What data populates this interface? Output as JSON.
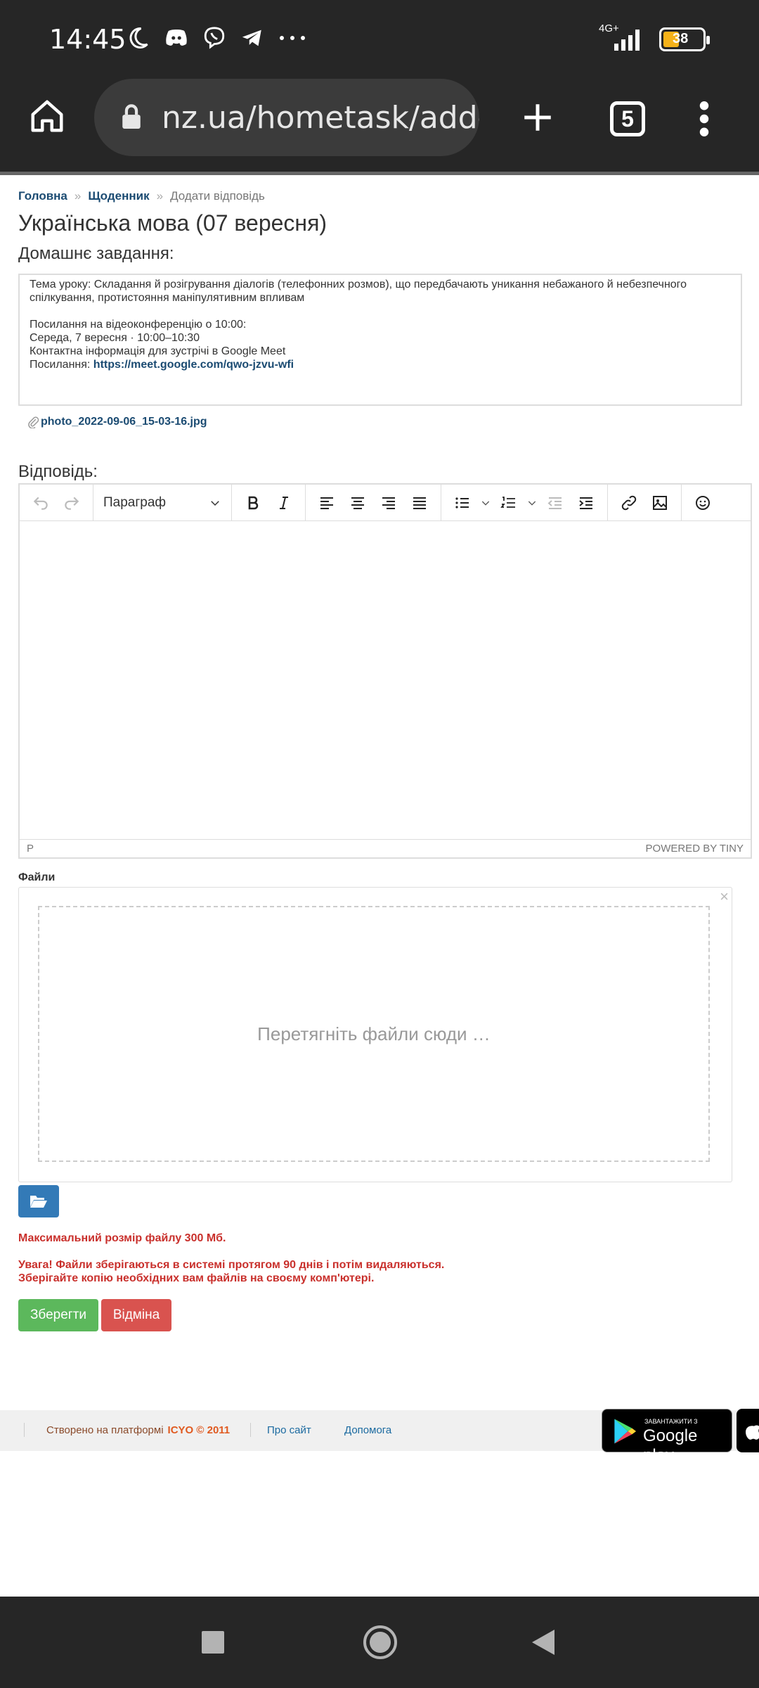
{
  "status_bar": {
    "time": "14:45",
    "network": "4G+",
    "battery": "38",
    "icons": [
      "moon-icon",
      "discord-icon",
      "viber-icon",
      "telegram-icon",
      "more-dots-icon",
      "signal-icon",
      "battery-icon"
    ]
  },
  "browser": {
    "url": "nz.ua/hometask/add-a",
    "tab_count": "5",
    "icons": [
      "home-icon",
      "lock-icon",
      "new-tab-icon",
      "menu-icon"
    ]
  },
  "breadcrumb": {
    "home": "Головна",
    "diary": "Щоденник",
    "current": "Додати відповідь",
    "separator": "»"
  },
  "page_title": "Українська мова (07 вересня)",
  "homework": {
    "label": "Домашнє завдання:",
    "topic": "Тема уроку: Складання й розігрування діалогів (телефонних розмов), що передбачають уникання небажаного й небезпечного спілкування, протистояння маніпулятивним впливам",
    "link_intro": "Посилання на відеоконференцію о 10:00:",
    "date_line": "Середа, 7 вересня · 10:00–10:30",
    "meet_info": "Контактна інформація для зустрічі в Google Meet",
    "link_label": "Посилання: ",
    "link_url": "https://meet.google.com/qwo-jzvu-wfi",
    "attachment": "photo_2022-09-06_15-03-16.jpg"
  },
  "answer": {
    "label": "Відповідь:",
    "format_select": "Параграф",
    "status_path": "P",
    "powered": "POWERED BY TINY"
  },
  "files": {
    "label": "Файли",
    "drop_hint": "Перетягніть файли сюди …",
    "close": "×",
    "max_size": "Максимальний розмір файлу 300 Мб.",
    "warning_1": "Увага! Файли зберігаються в системі протягом 90 днів і потім видаляються.",
    "warning_2": "Зберігайте копію необхідних вам файлів на своєму комп'ютері."
  },
  "actions": {
    "save": "Зберегти",
    "cancel": "Відміна"
  },
  "footer": {
    "created": "Створено на платформі",
    "brand": "ICYO © 2011",
    "about": "Про сайт",
    "help": "Допомога",
    "gplay_small": "ЗАВАНТАЖИТИ З",
    "gplay_big": "Google play"
  },
  "colors": {
    "link": "#1b4b72",
    "save": "#5cb85c",
    "cancel": "#d9534f",
    "browse": "#337ab7",
    "warning": "#c9302c"
  }
}
